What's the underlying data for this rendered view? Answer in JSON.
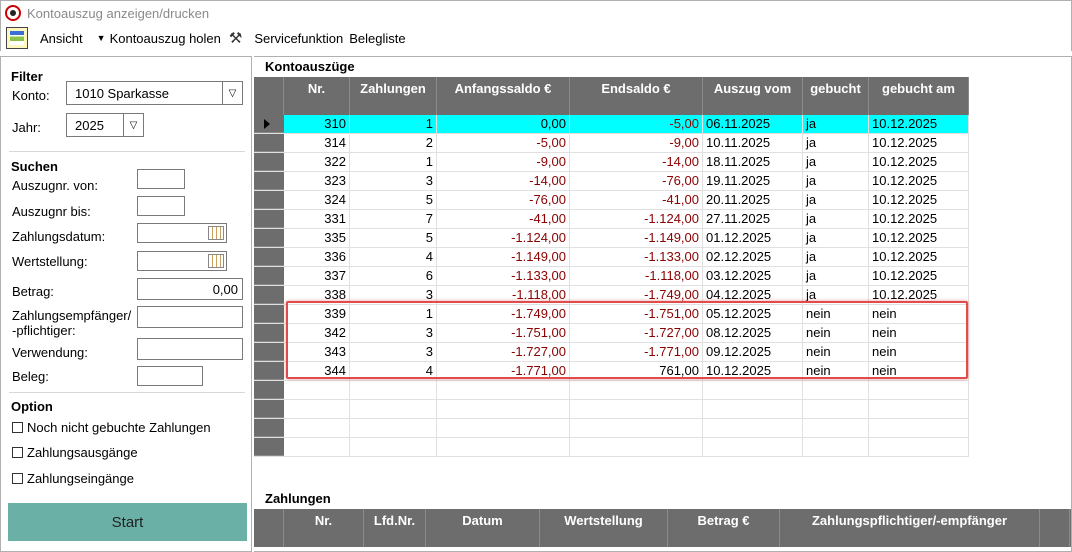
{
  "window": {
    "title": "Kontoauszug anzeigen/drucken"
  },
  "menu": {
    "ansicht": "Ansicht",
    "kontoauszug_holen": "Kontoauszug holen",
    "servicefunktion": "Servicefunktion",
    "belegliste": "Belegliste"
  },
  "filter": {
    "title": "Filter",
    "konto_label": "Konto:",
    "konto_value": "1010  Sparkasse",
    "jahr_label": "Jahr:",
    "jahr_value": "2025"
  },
  "suchen": {
    "title": "Suchen",
    "auszugnr_von": "Auszugnr. von:",
    "auszugnr_bis": "Auszugnr bis:",
    "zahlungsdatum": "Zahlungsdatum:",
    "wertstellung": "Wertstellung:",
    "betrag": "Betrag:",
    "betrag_value": "0,00",
    "empfaenger_1": "Zahlungsempfänger/",
    "empfaenger_2": "-pflichtiger:",
    "verwendung": "Verwendung:",
    "beleg": "Beleg:"
  },
  "option": {
    "title": "Option",
    "noch_nicht": "Noch nicht gebuchte Zahlungen",
    "ausgaenge": "Zahlungsausgänge",
    "eingaenge": "Zahlungseingänge"
  },
  "start_label": "Start",
  "kontoauszuege": {
    "title": "Kontoauszüge",
    "headers": [
      "Nr.",
      "Zahlungen",
      "Anfangssaldo  €",
      "Endsaldo  €",
      "Auszug vom",
      "gebucht",
      "gebucht am"
    ],
    "rows": [
      [
        "310",
        "1",
        "0,00",
        "-5,00",
        "06.11.2025",
        "ja",
        "10.12.2025"
      ],
      [
        "314",
        "2",
        "-5,00",
        "-9,00",
        "10.11.2025",
        "ja",
        "10.12.2025"
      ],
      [
        "322",
        "1",
        "-9,00",
        "-14,00",
        "18.11.2025",
        "ja",
        "10.12.2025"
      ],
      [
        "323",
        "3",
        "-14,00",
        "-76,00",
        "19.11.2025",
        "ja",
        "10.12.2025"
      ],
      [
        "324",
        "5",
        "-76,00",
        "-41,00",
        "20.11.2025",
        "ja",
        "10.12.2025"
      ],
      [
        "331",
        "7",
        "-41,00",
        "-1.124,00",
        "27.11.2025",
        "ja",
        "10.12.2025"
      ],
      [
        "335",
        "5",
        "-1.124,00",
        "-1.149,00",
        "01.12.2025",
        "ja",
        "10.12.2025"
      ],
      [
        "336",
        "4",
        "-1.149,00",
        "-1.133,00",
        "02.12.2025",
        "ja",
        "10.12.2025"
      ],
      [
        "337",
        "6",
        "-1.133,00",
        "-1.118,00",
        "03.12.2025",
        "ja",
        "10.12.2025"
      ],
      [
        "338",
        "3",
        "-1.118,00",
        "-1.749,00",
        "04.12.2025",
        "ja",
        "10.12.2025"
      ],
      [
        "339",
        "1",
        "-1.749,00",
        "-1.751,00",
        "05.12.2025",
        "nein",
        "nein"
      ],
      [
        "342",
        "3",
        "-1.751,00",
        "-1.727,00",
        "08.12.2025",
        "nein",
        "nein"
      ],
      [
        "343",
        "3",
        "-1.727,00",
        "-1.771,00",
        "09.12.2025",
        "nein",
        "nein"
      ],
      [
        "344",
        "4",
        "-1.771,00",
        "761,00",
        "10.12.2025",
        "nein",
        "nein"
      ]
    ]
  },
  "zahlungen": {
    "title": "Zahlungen",
    "headers": [
      "Nr.",
      "Lfd.Nr.",
      "Datum",
      "Wertstellung",
      "Betrag  €",
      "Zahlungspflichtiger/-empfänger"
    ]
  },
  "icons": {
    "app": "app-logo-icon",
    "view": "view-grid-icon",
    "tools": "tools-icon",
    "calendar": "calendar-icon"
  },
  "colors": {
    "selected_row": "#00ffff",
    "header_bg": "#6d6d6d",
    "start_button": "#6bb0a6",
    "negative": "#8b0000",
    "highlight": "#e04b4b"
  }
}
